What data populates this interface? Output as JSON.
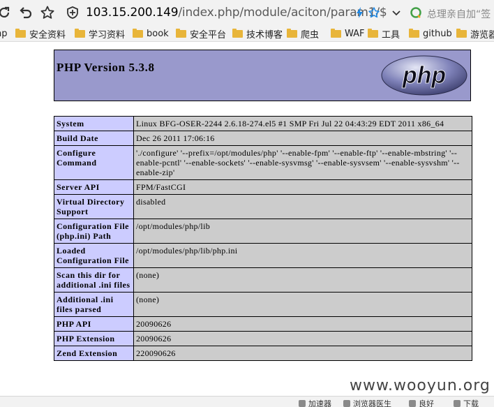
{
  "browser": {
    "url_host": "103.15.200.149",
    "url_path": "/index.php/module/aciton/param1/$",
    "search_placeholder": "总理亲自加“签",
    "bookmarks": [
      {
        "label": "hp",
        "folder": false
      },
      {
        "label": "安全资料",
        "folder": true
      },
      {
        "label": "学习资料",
        "folder": true
      },
      {
        "label": "book",
        "folder": true
      },
      {
        "label": "安全平台",
        "folder": true
      },
      {
        "label": "技术博客",
        "folder": true
      },
      {
        "label": "爬虫",
        "folder": true
      },
      {
        "label": "WAF",
        "folder": true
      },
      {
        "label": "工具",
        "folder": true
      },
      {
        "label": "github",
        "folder": true
      },
      {
        "label": "游览器",
        "folder": true
      }
    ]
  },
  "phpinfo": {
    "title": "PHP Version 5.3.8",
    "logo_text": "php",
    "rows": [
      {
        "key": "System",
        "value": "Linux BFG-OSER-2244 2.6.18-274.el5 #1 SMP Fri Jul 22 04:43:29 EDT 2011 x86_64"
      },
      {
        "key": "Build Date",
        "value": "Dec 26 2011 17:06:16"
      },
      {
        "key": "Configure Command",
        "value": "'./configure' '--prefix=/opt/modules/php' '--enable-fpm' '--enable-ftp' '--enable-mbstring' '--enable-pcntl' '--enable-sockets' '--enable-sysvmsg' '--enable-sysvsem' '--enable-sysvshm' '--enable-zip'"
      },
      {
        "key": "Server API",
        "value": "FPM/FastCGI"
      },
      {
        "key": "Virtual Directory Support",
        "value": "disabled"
      },
      {
        "key": "Configuration File (php.ini) Path",
        "value": "/opt/modules/php/lib"
      },
      {
        "key": "Loaded Configuration File",
        "value": "/opt/modules/php/lib/php.ini"
      },
      {
        "key": "Scan this dir for additional .ini files",
        "value": "(none)"
      },
      {
        "key": "Additional .ini files parsed",
        "value": "(none)"
      },
      {
        "key": "PHP API",
        "value": "20090626"
      },
      {
        "key": "PHP Extension",
        "value": "20090626"
      },
      {
        "key": "Zend Extension",
        "value": "220090626"
      }
    ]
  },
  "watermark": "www.wooyun.org",
  "statusbar": {
    "items": [
      "加速器",
      "浏览器医生",
      "良好",
      "下载"
    ]
  }
}
